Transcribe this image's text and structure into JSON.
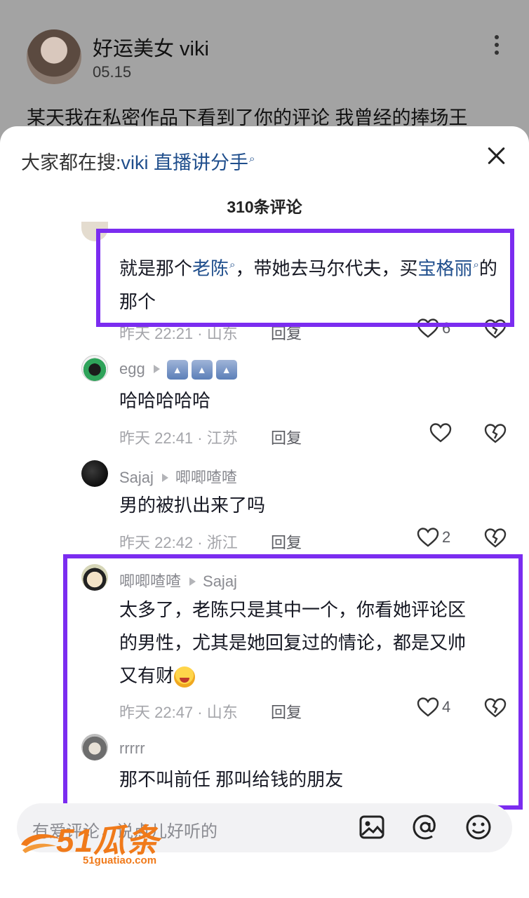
{
  "post": {
    "author": "好运美女 viki",
    "date": "05.15",
    "text": "某天我在私密作品下看到了你的评论 我曾经的捧场王"
  },
  "sheet": {
    "search_prefix": "大家都在搜:",
    "search_term": "viki 直播讲分手",
    "count_title": "310条评论"
  },
  "comments": [
    {
      "text_parts": [
        "就是那个",
        "老陈",
        "，带她去马尔代夫，买",
        "宝格丽",
        "的那个"
      ],
      "meta": "昨天 22:21 · 山东",
      "reply": "回复",
      "likes": "6"
    },
    {
      "user": "egg",
      "badges": [
        "▲",
        "▲",
        "▲"
      ],
      "text": "哈哈哈哈哈",
      "meta": "昨天 22:41 · 江苏",
      "reply": "回复",
      "likes": ""
    },
    {
      "user": "Sajaj",
      "reply_to": "唧唧喳喳",
      "text": "男的被扒出来了吗",
      "meta": "昨天 22:42 · 浙江",
      "reply": "回复",
      "likes": "2"
    },
    {
      "user": "唧唧喳喳",
      "reply_to": "Sajaj",
      "text_line1": "太多了，老陈只是其中一个，你看她评论区",
      "text_line2": "的男性，尤其是她回复过的情论，都是又帅",
      "text_line3": "又有财",
      "meta": "昨天 22:47 · 山东",
      "reply": "回复",
      "likes": "4"
    },
    {
      "user": "rrrrr",
      "text": "那不叫前任  那叫给钱的朋友"
    }
  ],
  "input": {
    "placeholder": "有爱评论，说点儿好听的"
  },
  "watermark": {
    "main": "51瓜条",
    "sub": "51guatiao.com"
  },
  "colors": {
    "highlight_box": "#7b2cf0",
    "link": "#1f4e8c",
    "watermark": "#f07a1a"
  }
}
